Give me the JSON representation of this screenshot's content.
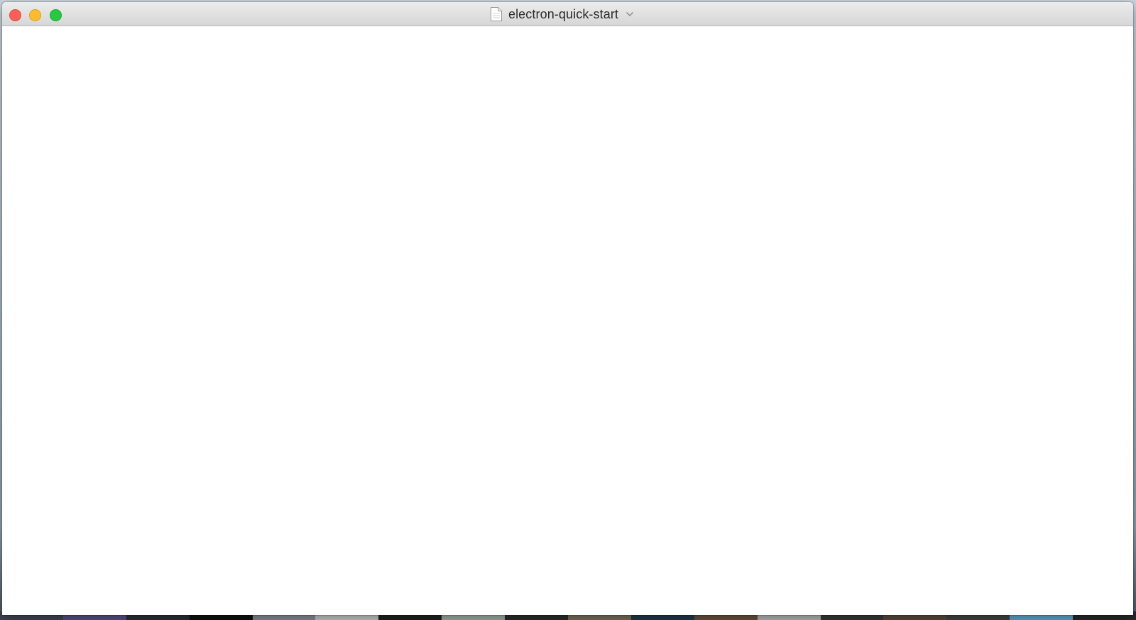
{
  "window": {
    "title": "electron-quick-start",
    "title_icon": "document-icon",
    "title_menu_icon": "chevron-down-icon",
    "controls": [
      {
        "name": "close",
        "color": "#fc5f57"
      },
      {
        "name": "minimize",
        "color": "#fdbc2e"
      },
      {
        "name": "zoom",
        "color": "#28c840"
      }
    ],
    "content_background": "#ffffff"
  }
}
